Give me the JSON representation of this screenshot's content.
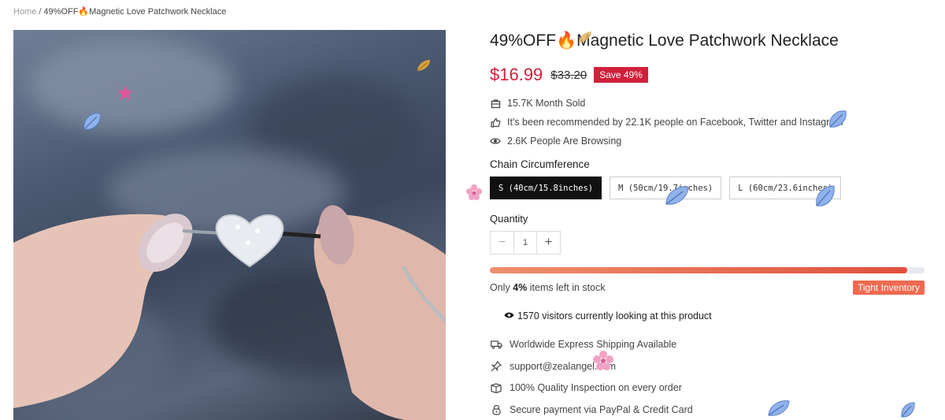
{
  "breadcrumb": {
    "home": "Home",
    "separator": "/",
    "current": "49%OFF🔥Magnetic Love Patchwork Necklace"
  },
  "product": {
    "title": "49%OFF🔥Magnetic Love Patchwork Necklace",
    "price": "$16.99",
    "compare_price": "$33.20",
    "save_badge": "Save 49%",
    "image_icon": "necklace-photo"
  },
  "stats": [
    {
      "icon": "bag-icon",
      "text": "15.7K Month Sold"
    },
    {
      "icon": "thumbs-up-icon",
      "text": "It's been recommended by 22.1K people on Facebook, Twitter and Instagram"
    },
    {
      "icon": "eye-icon",
      "text": "2.6K People Are Browsing"
    }
  ],
  "options": {
    "label": "Chain Circumference",
    "values": [
      "S (40cm/15.8inches)",
      "M (50cm/19.7inches)",
      "L (60cm/23.6inches)"
    ],
    "selected": "S (40cm/15.8inches)"
  },
  "quantity": {
    "label": "Quantity",
    "value": "1",
    "minus": "−",
    "plus": "+"
  },
  "stock": {
    "progress_percent": 96,
    "prefix": "Only ",
    "percent": "4%",
    "suffix": " items left in stock",
    "badge": "Tight Inventory"
  },
  "visitors": {
    "text": "1570 visitors currently looking at this product"
  },
  "features": [
    {
      "icon": "truck-icon",
      "text": "Worldwide Express Shipping Available"
    },
    {
      "icon": "pin-icon",
      "text": "support@zealangel.com"
    },
    {
      "icon": "box-icon",
      "text": "100% Quality Inspection on every order"
    },
    {
      "icon": "lock-icon",
      "text": "Secure payment via PayPal & Credit Card"
    }
  ],
  "colors": {
    "price": "#d0203a",
    "badge": "#d0203a",
    "tight_inventory": "#ef6a4f",
    "selected_option": "#111111"
  }
}
